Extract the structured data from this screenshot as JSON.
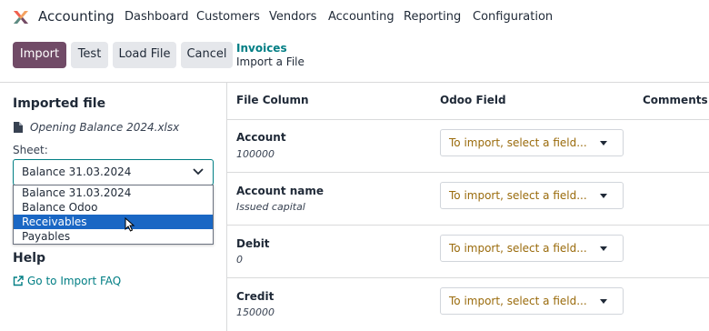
{
  "app": {
    "name": "Accounting",
    "brand_colors": [
      "#f06050",
      "#f4a261",
      "#5b8c85",
      "#714b67"
    ]
  },
  "nav": {
    "items": [
      "Dashboard",
      "Customers",
      "Vendors",
      "Accounting",
      "Reporting",
      "Configuration"
    ]
  },
  "toolbar": {
    "import_label": "Import",
    "test_label": "Test",
    "load_file_label": "Load File",
    "cancel_label": "Cancel"
  },
  "breadcrumb": {
    "parent": "Invoices",
    "current": "Import a File"
  },
  "sidebar": {
    "imported_file_title": "Imported file",
    "file_icon": "file-icon",
    "file_name": "Opening Balance 2024.xlsx",
    "sheet_label": "Sheet:",
    "sheet_selected": "Balance 31.03.2024",
    "sheet_options": [
      "Balance 31.03.2024",
      "Balance Odoo",
      "Receivables",
      "Payables"
    ],
    "highlighted_option": "Receivables",
    "help_title": "Help",
    "faq_link": "Go to Import FAQ"
  },
  "table": {
    "headers": [
      "File Column",
      "Odoo Field",
      "Comments"
    ],
    "rows": [
      {
        "name": "Account",
        "value": "100000",
        "field_placeholder": "To import, select a field..."
      },
      {
        "name": "Account name",
        "value": "Issued capital",
        "field_placeholder": "To import, select a field..."
      },
      {
        "name": "Debit",
        "value": "0",
        "field_placeholder": "To import, select a field..."
      },
      {
        "name": "Credit",
        "value": "150000",
        "field_placeholder": "To import, select a field..."
      }
    ]
  },
  "colors": {
    "primary": "#714b67",
    "link": "#017e84",
    "placeholder_text": "#9a6b0c",
    "dropdown_highlight": "#1a67c4"
  }
}
